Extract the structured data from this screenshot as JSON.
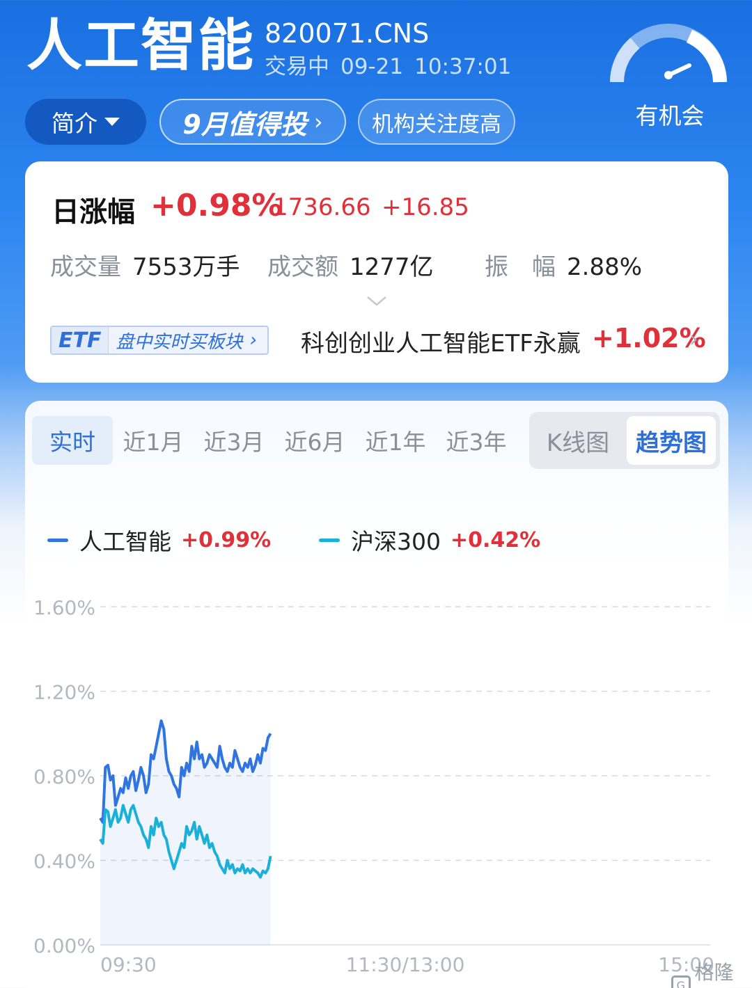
{
  "header": {
    "title": "人工智能",
    "code": "820071.CNS",
    "status": "交易中",
    "date": "09-21",
    "time": "10:37:01",
    "gauge_label": "有机会",
    "tags": {
      "intro": "简介",
      "invest": "9月值得投",
      "focus": "机构关注度高"
    }
  },
  "quote": {
    "daily_label": "日涨幅",
    "daily_pct": "+0.98%",
    "price": "1736.66",
    "change": "+16.85",
    "volume_label": "成交量",
    "volume_value": "7553万手",
    "turnover_label": "成交额",
    "turnover_value": "1277亿",
    "amplitude_label": "振　幅",
    "amplitude_value": "2.88%",
    "etf_badge": "ETF",
    "etf_badge_text": "盘中实时买板块",
    "etf_name": "科创创业人工智能ETF永赢",
    "etf_pct": "+1.02%"
  },
  "chart_tabs": [
    "实时",
    "近1月",
    "近3月",
    "近6月",
    "近1年",
    "近3年"
  ],
  "chart_modes": {
    "k": "K线图",
    "trend": "趋势图"
  },
  "legend": [
    {
      "name": "人工智能",
      "pct": "+0.99%",
      "color": "#2f74e0"
    },
    {
      "name": "沪深300",
      "pct": "+0.42%",
      "color": "#1bb0d8"
    }
  ],
  "watermark": "格隆汇",
  "chart_data": {
    "type": "line",
    "ylim": [
      0,
      1.6
    ],
    "yticks": [
      "1.60%",
      "1.20%",
      "0.80%",
      "0.40%",
      "0.00%"
    ],
    "xticks": [
      "09:30",
      "11:30/13:00",
      "15:00"
    ],
    "x": [
      "09:30",
      "09:31",
      "09:32",
      "09:33",
      "09:34",
      "09:35",
      "09:36",
      "09:37",
      "09:38",
      "09:39",
      "09:40",
      "09:41",
      "09:42",
      "09:43",
      "09:44",
      "09:45",
      "09:46",
      "09:47",
      "09:48",
      "09:49",
      "09:50",
      "09:51",
      "09:52",
      "09:53",
      "09:54",
      "09:55",
      "09:56",
      "09:57",
      "09:58",
      "09:59",
      "10:00",
      "10:01",
      "10:02",
      "10:03",
      "10:04",
      "10:05",
      "10:06",
      "10:07",
      "10:08",
      "10:09",
      "10:10",
      "10:11",
      "10:12",
      "10:13",
      "10:14",
      "10:15",
      "10:16",
      "10:17",
      "10:18",
      "10:19",
      "10:20",
      "10:21",
      "10:22",
      "10:23",
      "10:24",
      "10:25",
      "10:26",
      "10:27",
      "10:28",
      "10:29",
      "10:30",
      "10:31",
      "10:32",
      "10:33",
      "10:34",
      "10:35",
      "10:36",
      "10:37"
    ],
    "series": [
      {
        "name": "人工智能",
        "values": [
          0.6,
          0.58,
          0.84,
          0.85,
          0.78,
          0.8,
          0.66,
          0.7,
          0.74,
          0.72,
          0.79,
          0.74,
          0.8,
          0.82,
          0.73,
          0.78,
          0.84,
          0.8,
          0.72,
          0.76,
          0.9,
          0.88,
          0.94,
          1.0,
          1.06,
          1.02,
          0.88,
          0.82,
          0.8,
          0.76,
          0.74,
          0.7,
          0.84,
          0.8,
          0.86,
          0.82,
          0.94,
          0.88,
          0.96,
          0.88,
          0.9,
          0.84,
          0.86,
          0.9,
          0.88,
          0.86,
          0.84,
          0.94,
          0.88,
          0.84,
          0.82,
          0.86,
          0.84,
          0.92,
          0.88,
          0.84,
          0.82,
          0.86,
          0.84,
          0.88,
          0.82,
          0.85,
          0.9,
          0.86,
          0.93,
          0.92,
          0.98,
          1.0
        ]
      },
      {
        "name": "沪深300",
        "values": [
          0.5,
          0.48,
          0.64,
          0.63,
          0.56,
          0.6,
          0.64,
          0.58,
          0.6,
          0.66,
          0.62,
          0.58,
          0.64,
          0.66,
          0.62,
          0.58,
          0.56,
          0.52,
          0.5,
          0.46,
          0.56,
          0.52,
          0.6,
          0.56,
          0.58,
          0.52,
          0.5,
          0.44,
          0.4,
          0.36,
          0.4,
          0.44,
          0.48,
          0.46,
          0.56,
          0.52,
          0.54,
          0.58,
          0.5,
          0.56,
          0.52,
          0.48,
          0.52,
          0.46,
          0.48,
          0.44,
          0.42,
          0.38,
          0.36,
          0.34,
          0.4,
          0.36,
          0.38,
          0.34,
          0.36,
          0.35,
          0.38,
          0.34,
          0.36,
          0.34,
          0.36,
          0.35,
          0.34,
          0.32,
          0.35,
          0.34,
          0.36,
          0.42
        ]
      }
    ]
  }
}
